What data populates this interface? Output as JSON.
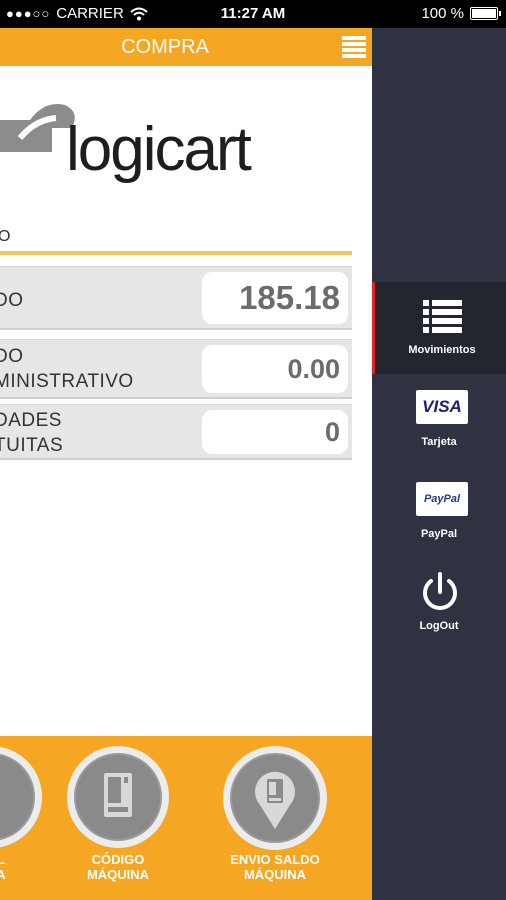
{
  "status_bar": {
    "signal": "●●●○○",
    "carrier": "CARRIER",
    "time": "11:27 AM",
    "battery": "100 %"
  },
  "header": {
    "title": "COMPRA"
  },
  "logo": {
    "text": "logicart"
  },
  "section": {
    "label": "O"
  },
  "rows": [
    {
      "label_lines": [
        "DO"
      ],
      "value": "185.18"
    },
    {
      "label_lines": [
        "DO",
        "MINISTRATIVO"
      ],
      "value": "0.00"
    },
    {
      "label_lines": [
        "DADES",
        "TUITAS"
      ],
      "value": "0"
    }
  ],
  "bottom_buttons": [
    {
      "label_lines": [
        "L",
        "A"
      ],
      "icon": "partial-icon"
    },
    {
      "label_lines": [
        "CÓDIGO",
        "MÁQUINA"
      ],
      "icon": "vending-machine-icon"
    },
    {
      "label_lines": [
        "ENVIO SALDO",
        "MÁQUINA"
      ],
      "icon": "vending-location-icon"
    }
  ],
  "side_menu": [
    {
      "label": "Movimientos",
      "icon": "list-icon",
      "active": true
    },
    {
      "label": "Tarjeta",
      "icon": "visa-card-icon",
      "card_text": "VISA"
    },
    {
      "label": "PayPal",
      "icon": "paypal-card-icon",
      "card_text": "PayPal"
    },
    {
      "label": "LogOut",
      "icon": "power-icon"
    }
  ],
  "colors": {
    "accent_orange": "#f5a623",
    "side_menu_bg": "#2f3240",
    "active_marker": "#e02424",
    "divider_gold": "#f0c75a"
  }
}
